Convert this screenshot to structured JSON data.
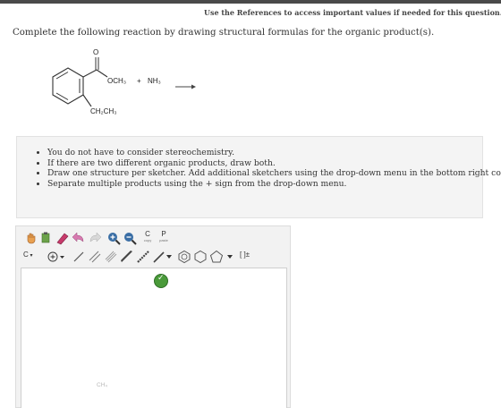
{
  "header": {
    "references_note": "Use the References to access important values if needed for this question."
  },
  "question": {
    "instruction": "Complete the following reaction by drawing structural formulas for the organic product(s)."
  },
  "reaction": {
    "carbonyl_oxygen": "O",
    "ester_group": "OCH₃",
    "plus": "+",
    "reagent": "NH₃",
    "arrow": "⟶",
    "ethyl_group": "CH₂CH₃"
  },
  "hints": [
    "You do not have to consider stereochemistry.",
    "If there are two different organic products, draw both.",
    "Draw one structure per sketcher. Add additional sketchers using the drop-down menu in the bottom right corner.",
    "Separate multiple products using the + sign from the drop-down menu."
  ],
  "sketcher": {
    "toolbar_top": {
      "copy_label": "C",
      "copy_sub": "copy",
      "paste_label": "P",
      "paste_sub": "paste"
    },
    "toolbar_bottom": {
      "element_label": "C",
      "bracket_label": "[ ]±"
    },
    "canvas_atom_label": "CH₄",
    "colors": {
      "ok_button": "#4a9a3a",
      "eraser": "#c73a6b",
      "zoom": "#3a6ea5"
    }
  }
}
